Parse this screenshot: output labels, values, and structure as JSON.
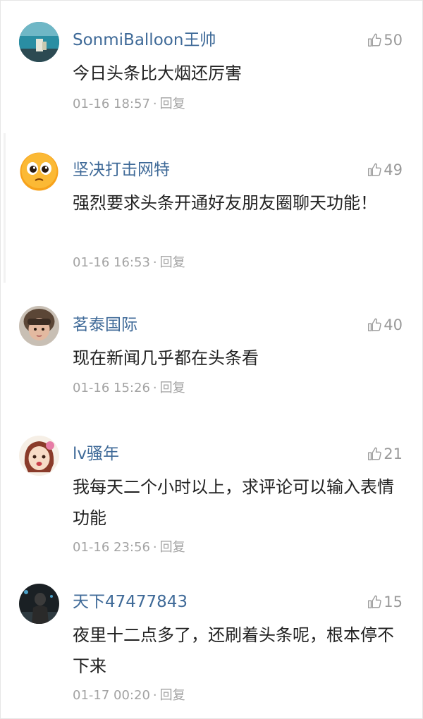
{
  "comments": [
    {
      "username": "SonmiBalloon王帅",
      "likes": "50",
      "text": "今日头条比大烟还厉害",
      "time": "01-16 18:57",
      "reply": "回复",
      "avatar": "avatar-scene-icon"
    },
    {
      "username": "坚决打击网特",
      "likes": "49",
      "text": "强烈要求头条开通好友朋友圈聊天功能！",
      "time": "01-16 16:53",
      "reply": "回复",
      "avatar": "emoji-face-icon"
    },
    {
      "username": "茗泰国际",
      "likes": "40",
      "text": "现在新闻几乎都在头条看",
      "time": "01-16 15:26",
      "reply": "回复",
      "avatar": "child-photo-icon"
    },
    {
      "username": "lv骚年",
      "likes": "21",
      "text": "我每天二个小时以上，求评论可以输入表情功能",
      "time": "01-16 23:56",
      "reply": "回复",
      "avatar": "cartoon-girl-icon"
    },
    {
      "username": "天下47477843",
      "likes": "15",
      "text": "夜里十二点多了，还刷着头条呢，根本停不下来",
      "time": "01-17 00:20",
      "reply": "回复",
      "avatar": "dark-figure-icon"
    }
  ],
  "colors": {
    "username": "#3f6a98",
    "text": "#222222",
    "meta": "#a3a3a3",
    "like": "#9a9a9a"
  }
}
